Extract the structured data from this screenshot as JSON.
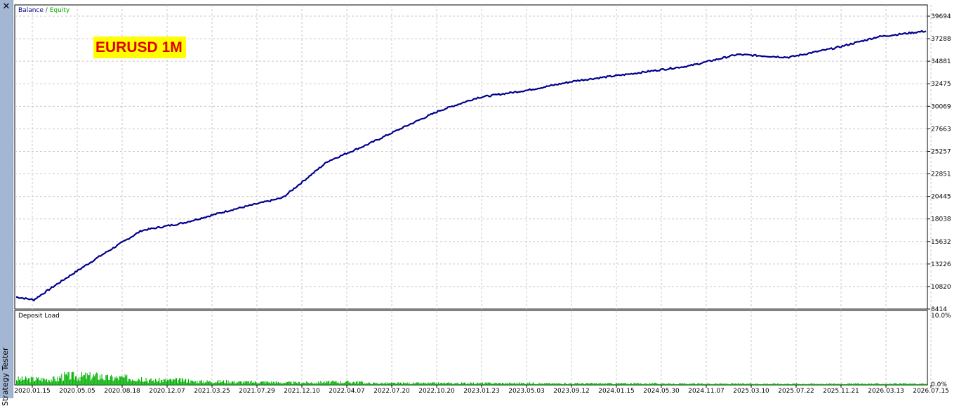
{
  "window": {
    "close_icon": "close-icon",
    "panel_title": "Strategy Tester"
  },
  "legend": {
    "balance": "Balance",
    "separator": "/",
    "equity": "Equity"
  },
  "banner": {
    "text": "EURUSD 1M",
    "background": "#ffff00",
    "color": "#e00000"
  },
  "colors": {
    "balance_line": "#00008b",
    "deposit_load_bars": "#00b000",
    "grid": "#c8c8c8"
  },
  "chart_data": [
    {
      "type": "line",
      "title": "",
      "series": [
        {
          "name": "Balance",
          "x": [
            "2020.01.15",
            "2020.03.01",
            "2020.05.05",
            "2020.08.18",
            "2020.12.07",
            "2021.03.25",
            "2021.07.29",
            "2021.12.10",
            "2022.04.07",
            "2022.07.20",
            "2022.10.20",
            "2023.01.23",
            "2023.05.03",
            "2023.09.12",
            "2024.01.15",
            "2024.05.30",
            "2024.11.07",
            "2025.03.10",
            "2025.07.22",
            "2025.11.21",
            "2026.03.13",
            "2026.07.15"
          ],
          "values": [
            9700,
            9400,
            11200,
            14000,
            16800,
            17600,
            19000,
            20300,
            24200,
            26000,
            27800,
            29600,
            31000,
            31800,
            32800,
            33500,
            34400,
            35600,
            35300,
            36300,
            37500,
            38100
          ]
        }
      ],
      "x_tick_labels": [
        "2020.01.15",
        "2020.05.05",
        "2020.08.18",
        "2020.12.07",
        "2021.03.25",
        "2021.07.29",
        "2021.12.10",
        "2022.04.07",
        "2022.07.20",
        "2022.10.20",
        "2023.01.23",
        "2023.05.03",
        "2023.09.12",
        "2024.01.15",
        "2024.05.30",
        "2024.11.07",
        "2025.03.10",
        "2025.07.22",
        "2025.11.21",
        "2026.03.13",
        "2026.07.15"
      ],
      "y_tick_labels": [
        "39694",
        "37288",
        "34881",
        "32475",
        "30069",
        "27663",
        "25257",
        "22851",
        "20445",
        "18038",
        "15632",
        "13226",
        "10820",
        "8414"
      ],
      "ylim": [
        8414,
        39694
      ],
      "grid": true,
      "legend": "top-left"
    },
    {
      "type": "bar",
      "title": "Deposit Load",
      "series": [
        {
          "name": "",
          "note_values_are_percent": true,
          "values": [
            1.0,
            1.5,
            1.2,
            0.8,
            0.6,
            0.5,
            0.4,
            0.5,
            0.3,
            0.3,
            0.3,
            0.3,
            0.25,
            0.25,
            0.25,
            0.2,
            0.2,
            0.2,
            0.2,
            0.2,
            0.2
          ]
        }
      ],
      "y_tick_labels": [
        "10.0%",
        "0.0%"
      ],
      "ylim": [
        0,
        10
      ],
      "grid": true
    }
  ]
}
